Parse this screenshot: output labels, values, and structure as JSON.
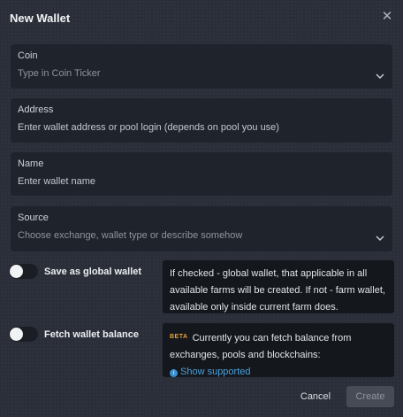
{
  "dialog": {
    "title": "New Wallet",
    "close_icon": "close-icon"
  },
  "fields": {
    "coin": {
      "label": "Coin",
      "placeholder": "Type in Coin Ticker"
    },
    "address": {
      "label": "Address",
      "placeholder": "Enter wallet address or pool login (depends on pool you use)"
    },
    "name": {
      "label": "Name",
      "placeholder": "Enter wallet name"
    },
    "source": {
      "label": "Source",
      "placeholder": "Choose exchange, wallet type or describe somehow"
    }
  },
  "toggles": {
    "global": {
      "label": "Save as global wallet",
      "checked": false,
      "tip": "If checked - global wallet, that applicable in all available farms will be created. If not - farm wallet, available only inside current farm does."
    },
    "balance": {
      "label": "Fetch wallet balance",
      "checked": false,
      "badge": "BETA",
      "tip": "Currently you can fetch balance from exchanges, pools and blockchains:",
      "link": "Show supported"
    }
  },
  "buttons": {
    "cancel": "Cancel",
    "create": "Create"
  },
  "colors": {
    "accent_link": "#4aa3df",
    "beta": "#e8a33a",
    "field_bg": "#1f232b"
  }
}
